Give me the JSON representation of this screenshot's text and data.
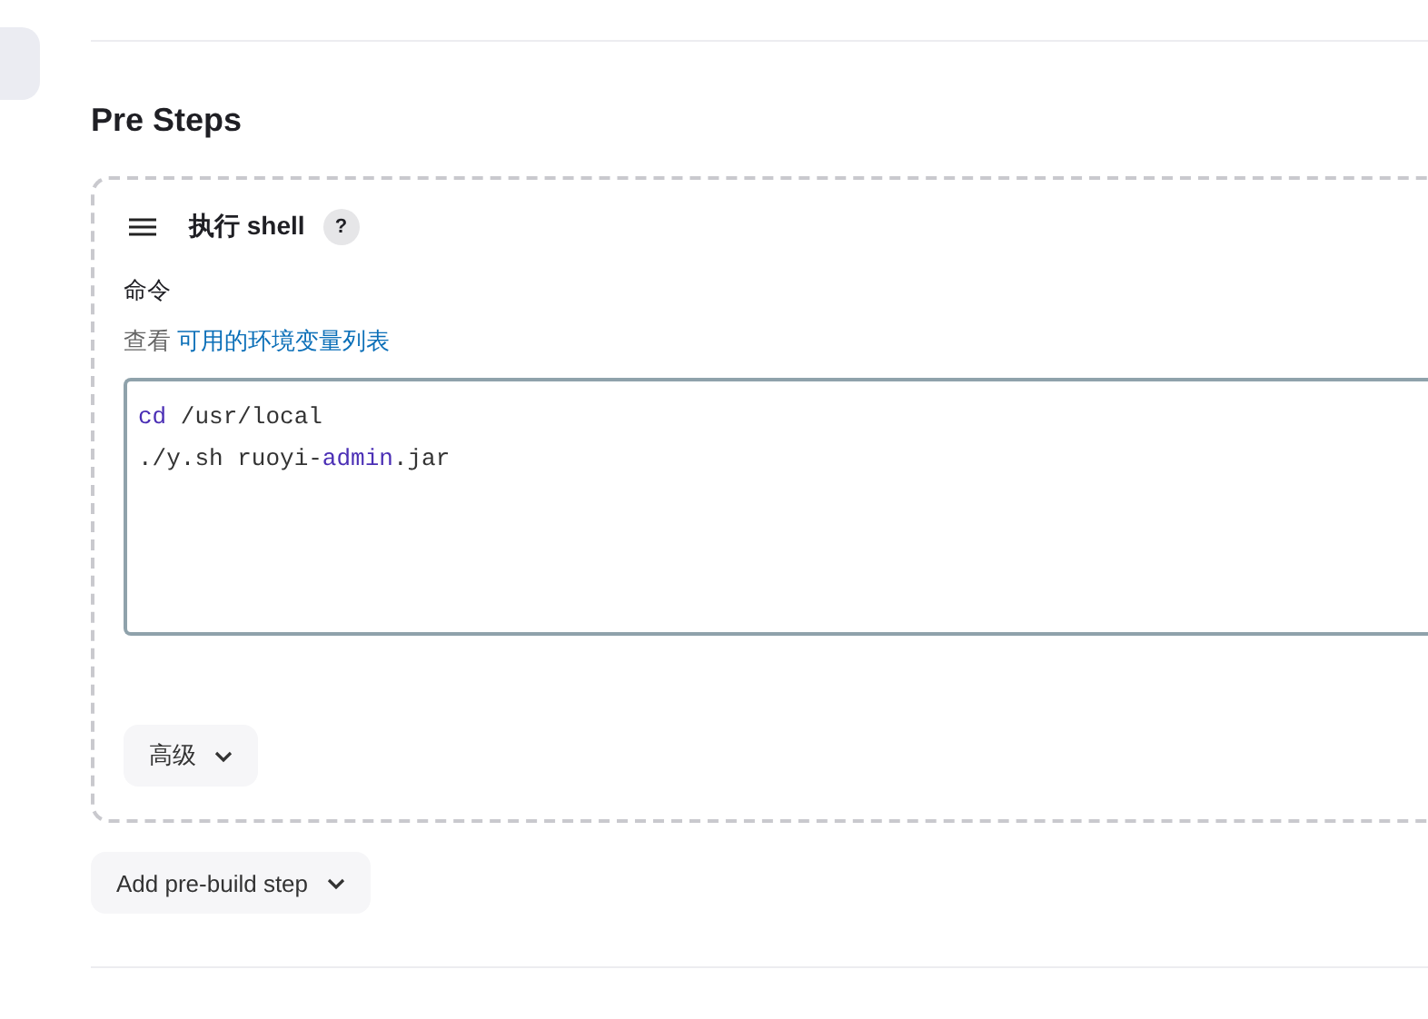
{
  "section": {
    "title": "Pre Steps"
  },
  "step": {
    "title": "执行 shell",
    "help": "?",
    "field_label": "命令",
    "hint_prefix": "查看",
    "hint_link": "可用的环境变量列表",
    "code_lines": [
      [
        {
          "text": "cd",
          "kind": "keyword"
        },
        {
          "text": " /usr/local",
          "kind": "plain"
        }
      ],
      [
        {
          "text": "./y.sh ruoyi-",
          "kind": "plain"
        },
        {
          "text": "admin",
          "kind": "keyword"
        },
        {
          "text": ".jar",
          "kind": "plain"
        }
      ]
    ],
    "advanced_button": "高级"
  },
  "add_button": "Add pre-build step"
}
